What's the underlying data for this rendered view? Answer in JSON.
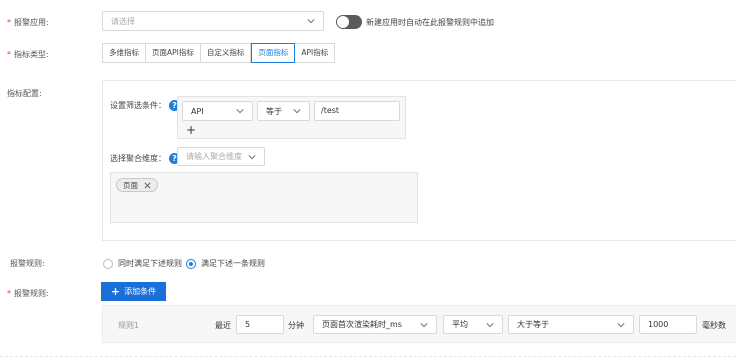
{
  "alert_app": {
    "label": "报警应用:",
    "select_placeholder": "请选择",
    "toggle_label": "新建应用时自动在此报警规则中追加"
  },
  "metric_type": {
    "label": "指标类型:",
    "tabs": [
      "多维指标",
      "页面API指标",
      "自定义指标",
      "页面指标",
      "API指标"
    ]
  },
  "metric_config": {
    "label": "指标配置:",
    "filter_label": "设置筛选条件：",
    "filter_field": "API",
    "filter_op": "等于",
    "filter_value": "/test",
    "add_symbol": "+",
    "agg_label": "选择聚合维度：",
    "agg_placeholder": "请输入聚合维度",
    "tag_label": "页面"
  },
  "alert_rule_mode": {
    "label": "报警规则:",
    "option_all": "同时满足下述规则",
    "option_any": "满足下述一条规则"
  },
  "alert_rules": {
    "label": "报警规则:",
    "add_button": "添加条件",
    "rule_name": "规则1",
    "recent_label": "最近",
    "minutes_value": "5",
    "minutes_unit": "分钟",
    "metric_select": "页面首次渲染耗时_ms",
    "agg_select": "平均",
    "compare_select": "大于等于",
    "threshold_value": "1000",
    "threshold_unit": "毫秒数"
  },
  "colors": {
    "accent": "#1a7ee0",
    "required": "#e4393c",
    "primary_button": "#1a6fd8"
  }
}
